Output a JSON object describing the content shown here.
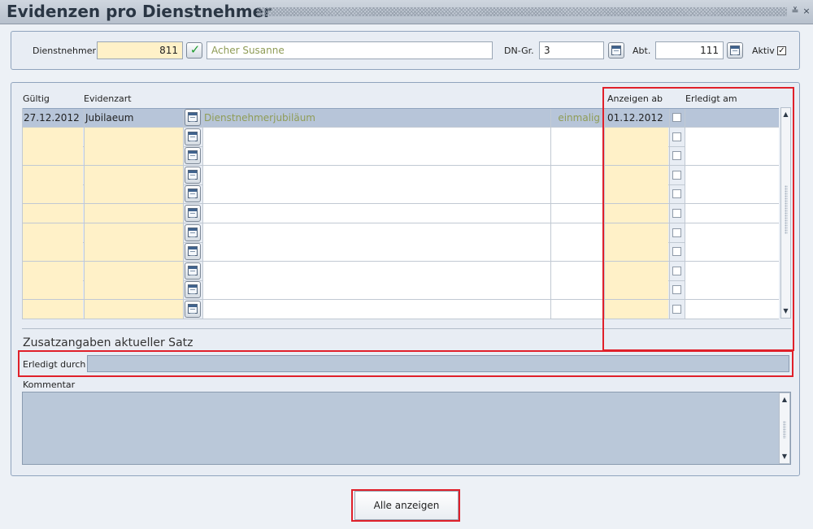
{
  "window": {
    "title": "Evidenzen pro Dienstnehmer",
    "minimize_glyph": "≚",
    "close_glyph": "×"
  },
  "header": {
    "dienstnehmer_label": "Dienstnehmer",
    "dienstnehmer_number": "811",
    "dienstnehmer_name": "Acher Susanne",
    "dn_gr_label": "DN-Gr.",
    "dn_gr_value": "3",
    "abt_label": "Abt.",
    "abt_value": "111",
    "aktiv_label": "Aktiv",
    "aktiv_checked": true
  },
  "grid": {
    "columns": {
      "gueltig": "Gültig",
      "evidenzart": "Evidenzart",
      "anzeigen_ab": "Anzeigen ab",
      "erledigt_am": "Erledigt am"
    },
    "rows": [
      {
        "gueltig": "27.12.2012",
        "evidenzart": "Jubilaeum",
        "beschreibung": "Dienstnehmerjubiläum",
        "art": "einmalig",
        "anzeigen_ab": "01.12.2012",
        "erledigt": false,
        "erledigt_am": ""
      }
    ],
    "empty_rows": 10
  },
  "details": {
    "section_title": "Zusatzangaben aktueller Satz",
    "erledigt_durch_label": "Erledigt durch",
    "erledigt_durch_value": "",
    "kommentar_label": "Kommentar",
    "kommentar_value": ""
  },
  "footer": {
    "show_all_label": "Alle anzeigen"
  },
  "colors": {
    "required_field": "#fff1c8",
    "selected_row": "#b7c5d9",
    "highlight": "#e0202a"
  },
  "icons": {
    "picker": "calendar-list-icon",
    "confirm": "green-check-icon"
  }
}
